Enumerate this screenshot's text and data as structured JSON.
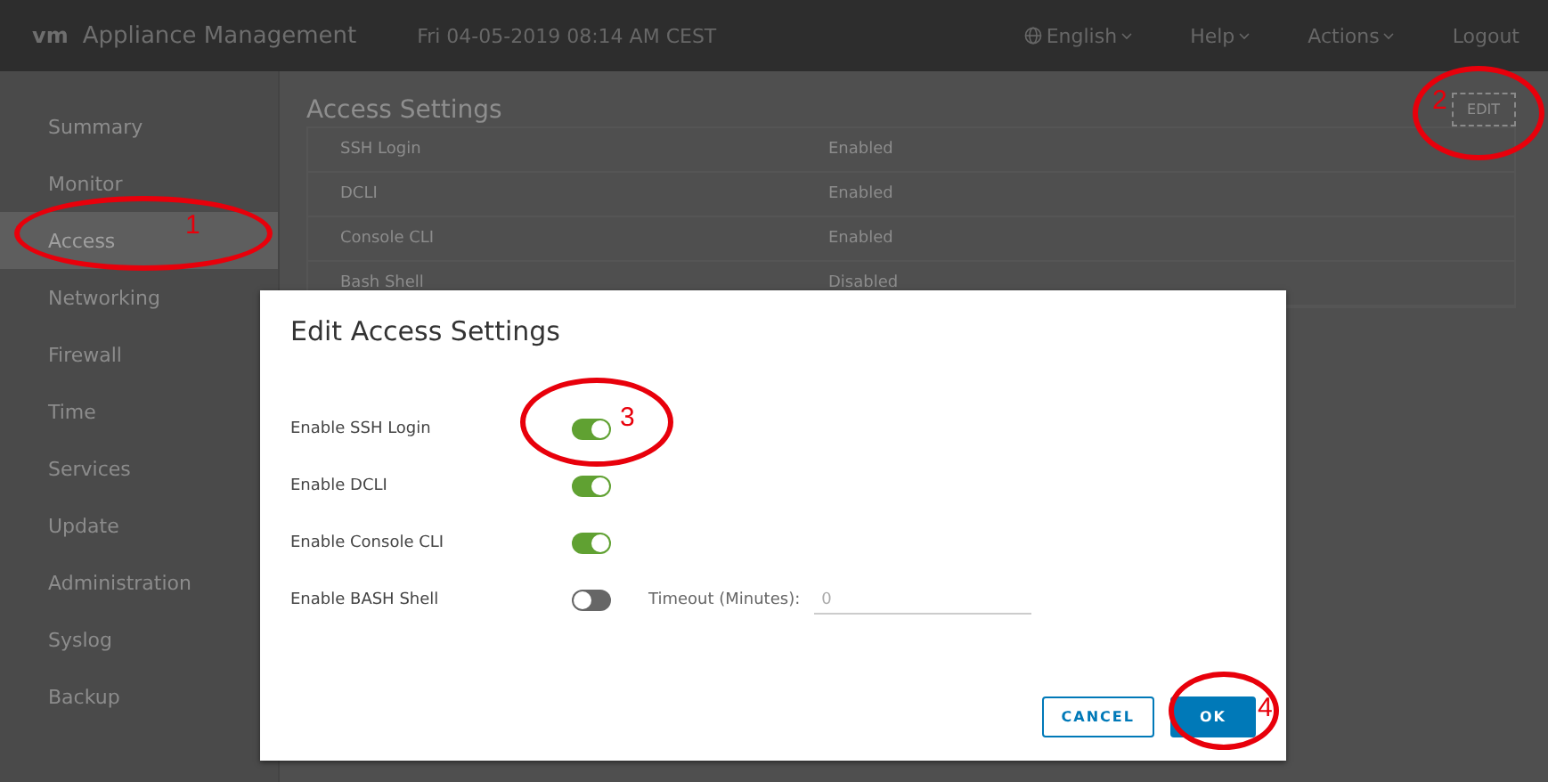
{
  "header": {
    "logo": "vm",
    "title": "Appliance Management",
    "datetime": "Fri 04-05-2019 08:14 AM CEST",
    "menus": [
      {
        "label": "English",
        "kind": "language"
      },
      {
        "label": "Help",
        "kind": "dropdown"
      },
      {
        "label": "Actions",
        "kind": "dropdown"
      },
      {
        "label": "Logout",
        "kind": "link"
      }
    ]
  },
  "sidebar": {
    "items": [
      {
        "label": "Summary",
        "selected": false
      },
      {
        "label": "Monitor",
        "selected": false
      },
      {
        "label": "Access",
        "selected": true
      },
      {
        "label": "Networking",
        "selected": false
      },
      {
        "label": "Firewall",
        "selected": false
      },
      {
        "label": "Time",
        "selected": false
      },
      {
        "label": "Services",
        "selected": false
      },
      {
        "label": "Update",
        "selected": false
      },
      {
        "label": "Administration",
        "selected": false
      },
      {
        "label": "Syslog",
        "selected": false
      },
      {
        "label": "Backup",
        "selected": false
      }
    ]
  },
  "main": {
    "title": "Access Settings",
    "edit_button": "EDIT",
    "rows": [
      {
        "name": "SSH Login",
        "value": "Enabled"
      },
      {
        "name": "DCLI",
        "value": "Enabled"
      },
      {
        "name": "Console CLI",
        "value": "Enabled"
      },
      {
        "name": "Bash Shell",
        "value": "Disabled"
      }
    ]
  },
  "dialog": {
    "title": "Edit Access Settings",
    "settings": [
      {
        "label": "Enable SSH Login",
        "on": true
      },
      {
        "label": "Enable DCLI",
        "on": true
      },
      {
        "label": "Enable Console CLI",
        "on": true
      },
      {
        "label": "Enable BASH Shell",
        "on": false,
        "timeout_label": "Timeout (Minutes):",
        "timeout_placeholder": "0"
      }
    ],
    "buttons": [
      {
        "label": "CANCEL",
        "kind": "secondary"
      },
      {
        "label": "OK",
        "kind": "primary"
      }
    ]
  },
  "annotations": [
    {
      "label": "1"
    },
    {
      "label": "2"
    },
    {
      "label": "3"
    },
    {
      "label": "4"
    }
  ]
}
